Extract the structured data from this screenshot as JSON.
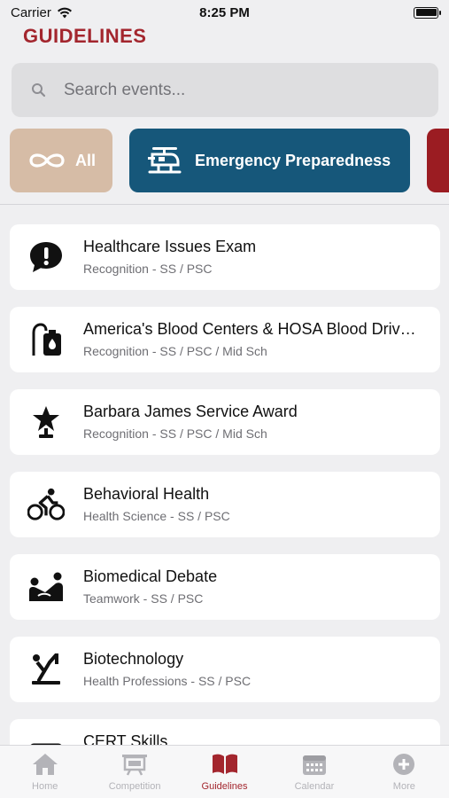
{
  "status": {
    "carrier": "Carrier",
    "time": "8:25 PM"
  },
  "header": {
    "title": "GUIDELINES"
  },
  "search": {
    "placeholder": "Search events..."
  },
  "filters": [
    {
      "label": "All",
      "icon": "infinity-icon",
      "color": "#d6bca6"
    },
    {
      "label": "Emergency Preparedness",
      "icon": "helicopter-icon",
      "color": "#16577a"
    },
    {
      "label": "",
      "icon": "",
      "color": "#9b1c22"
    }
  ],
  "events": [
    {
      "title": "Healthcare Issues Exam",
      "subtitle": "Recognition - SS / PSC",
      "icon": "exclamation-bubble-icon"
    },
    {
      "title": "America's Blood Centers & HOSA Blood Drive Recognition",
      "subtitle": "Recognition - SS / PSC / Mid Sch",
      "icon": "blood-bag-icon"
    },
    {
      "title": "Barbara James Service Award",
      "subtitle": "Recognition - SS / PSC / Mid Sch",
      "icon": "star-trophy-icon"
    },
    {
      "title": "Behavioral Health",
      "subtitle": "Health Science - SS / PSC",
      "icon": "cyclist-icon"
    },
    {
      "title": "Biomedical Debate",
      "subtitle": "Teamwork - SS / PSC",
      "icon": "debate-icon"
    },
    {
      "title": "Biotechnology",
      "subtitle": "Health Professions - SS / PSC",
      "icon": "microscope-icon"
    },
    {
      "title": "CERT Skills",
      "subtitle": "",
      "icon": "kit-icon"
    }
  ],
  "tabs": [
    {
      "label": "Home",
      "icon": "home-icon",
      "active": false
    },
    {
      "label": "Competition",
      "icon": "presentation-icon",
      "active": false
    },
    {
      "label": "Guidelines",
      "icon": "book-icon",
      "active": true
    },
    {
      "label": "Calendar",
      "icon": "calendar-icon",
      "active": false
    },
    {
      "label": "More",
      "icon": "plus-circle-icon",
      "active": false
    }
  ],
  "colors": {
    "accent": "#a3262e",
    "inactive": "#b3b3b8"
  }
}
